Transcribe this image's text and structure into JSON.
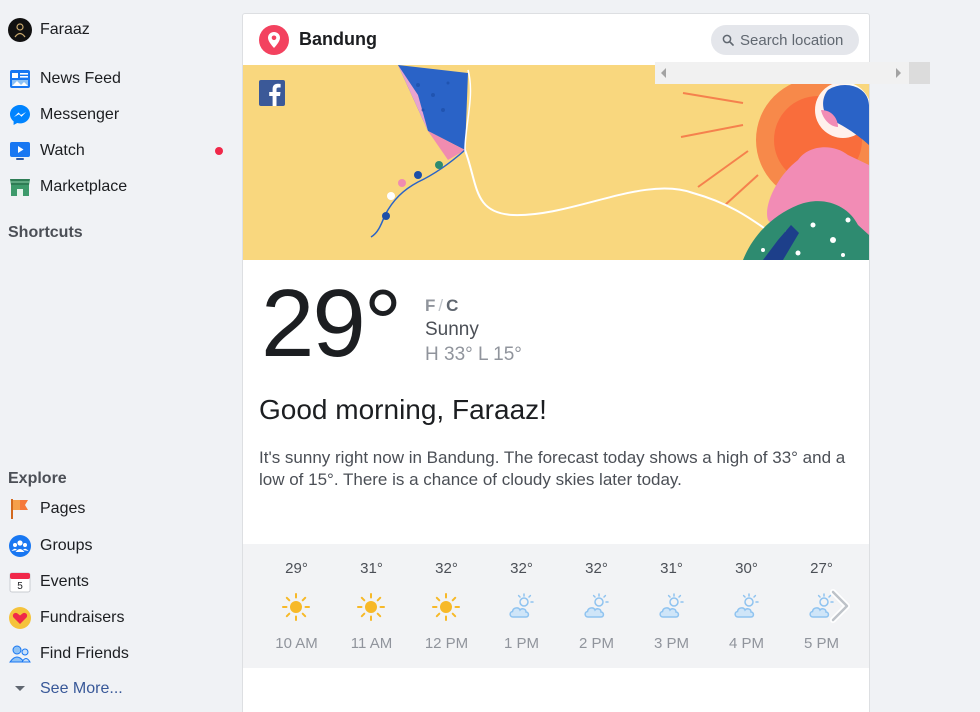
{
  "sidebar": {
    "profile": {
      "name": "Faraaz"
    },
    "items": [
      {
        "label": "News Feed",
        "icon": "news-feed-icon"
      },
      {
        "label": "Messenger",
        "icon": "messenger-icon"
      },
      {
        "label": "Watch",
        "icon": "watch-icon"
      },
      {
        "label": "Marketplace",
        "icon": "marketplace-icon"
      }
    ],
    "shortcuts_heading": "Shortcuts",
    "explore_heading": "Explore",
    "explore": [
      {
        "label": "Pages",
        "icon": "pages-flag-icon"
      },
      {
        "label": "Groups",
        "icon": "groups-icon"
      },
      {
        "label": "Events",
        "icon": "events-calendar-icon"
      },
      {
        "label": "Fundraisers",
        "icon": "fundraisers-heart-icon"
      },
      {
        "label": "Find Friends",
        "icon": "find-friends-icon"
      }
    ],
    "see_more": "See More..."
  },
  "weather": {
    "city": "Bandung",
    "search_placeholder": "Search location",
    "temperature": "29°",
    "unit_f": "F",
    "unit_sep": "/",
    "unit_c": "C",
    "condition": "Sunny",
    "high_low": "H 33° L 15°",
    "greeting": "Good morning, Faraaz!",
    "description": "It's sunny right now in Bandung. The forecast today shows a high of 33° and a low of 15°. There is a chance of cloudy skies later today.",
    "forecast": [
      {
        "temp": "29°",
        "hour": "10 AM",
        "icon": "sun-icon"
      },
      {
        "temp": "31°",
        "hour": "11 AM",
        "icon": "sun-icon"
      },
      {
        "temp": "32°",
        "hour": "12 PM",
        "icon": "sun-icon"
      },
      {
        "temp": "32°",
        "hour": "1 PM",
        "icon": "partly-cloudy-icon"
      },
      {
        "temp": "32°",
        "hour": "2 PM",
        "icon": "partly-cloudy-icon"
      },
      {
        "temp": "31°",
        "hour": "3 PM",
        "icon": "partly-cloudy-icon"
      },
      {
        "temp": "30°",
        "hour": "4 PM",
        "icon": "partly-cloudy-icon"
      },
      {
        "temp": "27°",
        "hour": "5 PM",
        "icon": "partly-cloudy-icon"
      }
    ]
  },
  "colors": {
    "accent": "#1877f2",
    "pin": "#f3425f",
    "banner": "#f9d77e",
    "sun": "#f7b928",
    "cloud": "#8fc3f0",
    "notification_dot": "#f02849"
  }
}
